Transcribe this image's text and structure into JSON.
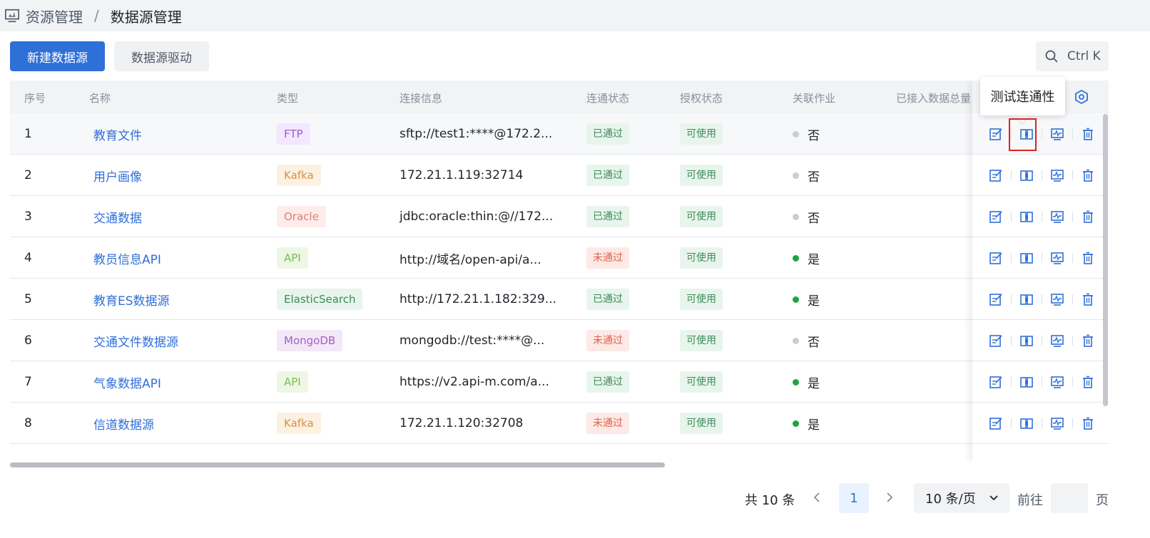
{
  "breadcrumb": {
    "root": "资源管理",
    "separator": "/",
    "current": "数据源管理"
  },
  "toolbar": {
    "new_label": "新建数据源",
    "driver_label": "数据源驱动",
    "search_hint": "Ctrl K"
  },
  "table": {
    "headers": {
      "index": "序号",
      "name": "名称",
      "type": "类型",
      "conn": "连接信息",
      "status": "连通状态",
      "auth": "授权状态",
      "linked": "关联作业",
      "total": "已接入数据总量"
    },
    "rows": [
      {
        "index": "1",
        "name": "教育文件",
        "type": "FTP",
        "conn": "sftp://test1:****@172.2...",
        "status": "已通过",
        "auth": "可使用",
        "linked": "否"
      },
      {
        "index": "2",
        "name": "用户画像",
        "type": "Kafka",
        "conn": "172.21.1.119:32714",
        "status": "已通过",
        "auth": "可使用",
        "linked": "否"
      },
      {
        "index": "3",
        "name": "交通数据",
        "type": "Oracle",
        "conn": "jdbc:oracle:thin:@//172...",
        "status": "已通过",
        "auth": "可使用",
        "linked": "否"
      },
      {
        "index": "4",
        "name": "教员信息API",
        "type": "API",
        "conn": "http://域名/open-api/a...",
        "status": "未通过",
        "auth": "可使用",
        "linked": "是"
      },
      {
        "index": "5",
        "name": "教育ES数据源",
        "type": "ElasticSearch",
        "conn": "http://172.21.1.182:329...",
        "status": "已通过",
        "auth": "可使用",
        "linked": "是"
      },
      {
        "index": "6",
        "name": "交通文件数据源",
        "type": "MongoDB",
        "conn": "mongodb://test:****@...",
        "status": "未通过",
        "auth": "可使用",
        "linked": "否"
      },
      {
        "index": "7",
        "name": "气象数据API",
        "type": "API",
        "conn": "https://v2.api-m.com/a...",
        "status": "已通过",
        "auth": "可使用",
        "linked": "是"
      },
      {
        "index": "8",
        "name": "信道数据源",
        "type": "Kafka",
        "conn": "172.21.1.120:32708",
        "status": "未通过",
        "auth": "可使用",
        "linked": "是"
      }
    ]
  },
  "tooltip": {
    "text": "测试连通性"
  },
  "pagination": {
    "total": "共 10 条",
    "current_page": "1",
    "page_size": "10 条/页",
    "goto": "前往",
    "unit": "页"
  },
  "colors": {
    "primary": "#2f6fd8",
    "pass": "#e8f5ec",
    "fail": "#fde9e6"
  }
}
